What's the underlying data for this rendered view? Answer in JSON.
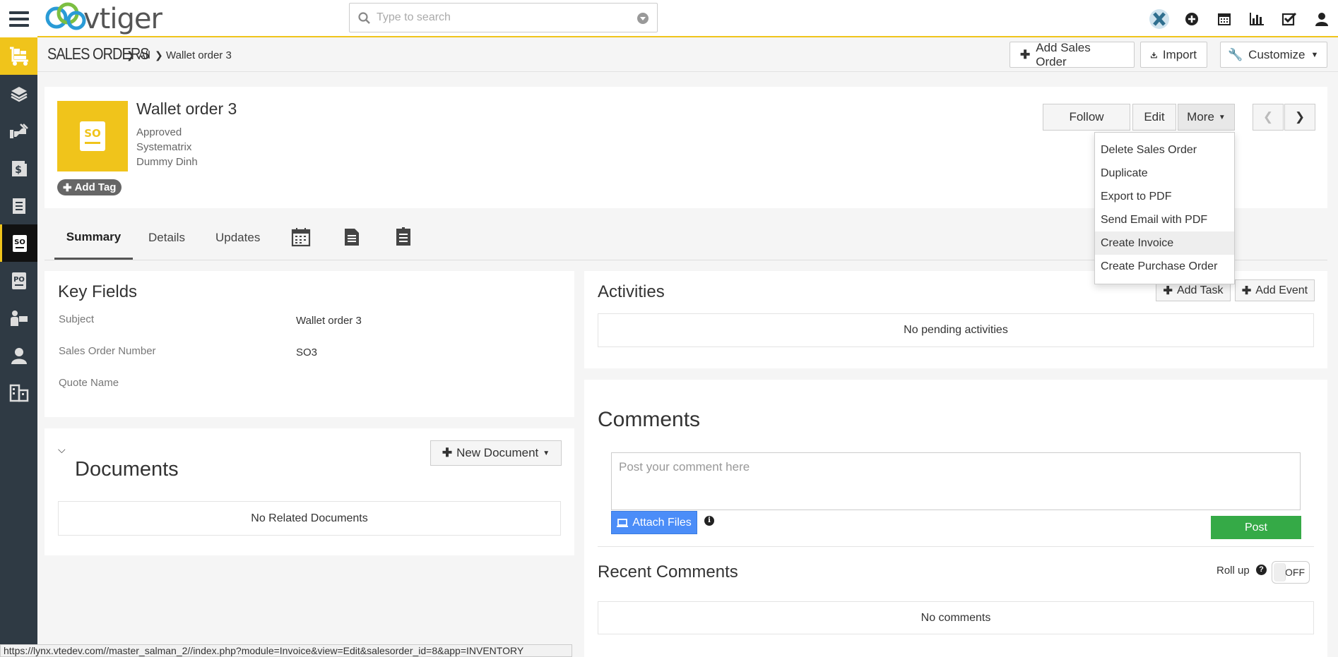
{
  "app": {
    "logo_text": "vtiger",
    "accent_color": "#f0c41b",
    "sidebar_color": "#2f3a44"
  },
  "search": {
    "placeholder": "Type to search"
  },
  "top_icons": [
    "vtiger-x-icon",
    "plus-circle-icon",
    "calendar-icon",
    "bar-chart-icon",
    "checkbox-icon",
    "user-icon"
  ],
  "sidebar": {
    "items": [
      "inventory-icon",
      "layers-icon",
      "handshake-icon",
      "invoice-icon",
      "book-icon",
      "sales-order-icon",
      "purchase-order-icon",
      "vendor-icon",
      "contact-icon",
      "organization-icon"
    ]
  },
  "breadcrumb": {
    "module": "SALES ORDERS",
    "filter": "All",
    "record": "Wallet order 3"
  },
  "header_buttons": {
    "add": "Add Sales Order",
    "import": "Import",
    "customize": "Customize"
  },
  "record": {
    "icon_text": "SO",
    "title": "Wallet order 3",
    "status": "Approved",
    "organization": "Systematrix",
    "owner": "Dummy Dinh",
    "add_tag": "Add Tag"
  },
  "actions": {
    "follow": "Follow",
    "edit": "Edit",
    "more": "More"
  },
  "more_menu": [
    "Delete Sales Order",
    "Duplicate",
    "Export to PDF",
    "Send Email with PDF",
    "Create Invoice",
    "Create Purchase Order"
  ],
  "tabs": {
    "summary": "Summary",
    "details": "Details",
    "updates": "Updates"
  },
  "key_fields": {
    "title": "Key Fields",
    "rows": [
      {
        "label": "Subject",
        "value": "Wallet order 3"
      },
      {
        "label": "Sales Order Number",
        "value": "SO3"
      },
      {
        "label": "Quote Name",
        "value": ""
      }
    ]
  },
  "documents": {
    "title": "Documents",
    "new_button": "New Document",
    "empty": "No Related Documents"
  },
  "activities": {
    "title": "Activities",
    "add_task": "Add Task",
    "add_event": "Add Event",
    "empty": "No pending activities"
  },
  "comments": {
    "title": "Comments",
    "placeholder": "Post your comment here",
    "attach": "Attach Files",
    "post": "Post",
    "recent_title": "Recent Comments",
    "roll_up": "Roll up",
    "toggle": "OFF",
    "empty": "No comments"
  },
  "status_url": "https://lynx.vtedev.com//master_salman_2//index.php?module=Invoice&view=Edit&salesorder_id=8&app=INVENTORY"
}
